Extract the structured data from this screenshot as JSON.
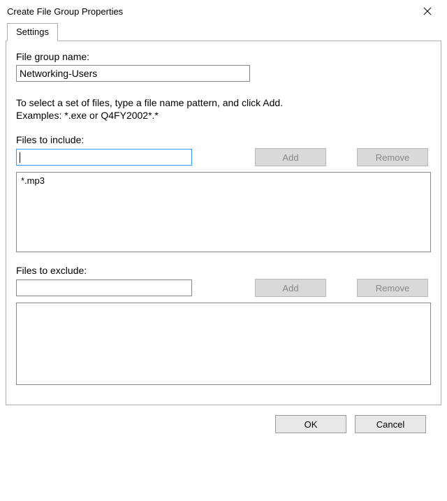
{
  "window": {
    "title": "Create File Group Properties"
  },
  "tabs": {
    "settings": "Settings"
  },
  "form": {
    "name_label": "File group name:",
    "name_value": "Networking-Users",
    "hint_line1": "To select a set of files, type a file name pattern, and click Add.",
    "hint_line2": "Examples: *.exe or Q4FY2002*.*",
    "include": {
      "label": "Files to include:",
      "input_value": "",
      "add_btn": "Add",
      "remove_btn": "Remove",
      "items": [
        "*.mp3"
      ]
    },
    "exclude": {
      "label": "Files to exclude:",
      "input_value": "",
      "add_btn": "Add",
      "remove_btn": "Remove",
      "items": []
    }
  },
  "buttons": {
    "ok": "OK",
    "cancel": "Cancel"
  }
}
